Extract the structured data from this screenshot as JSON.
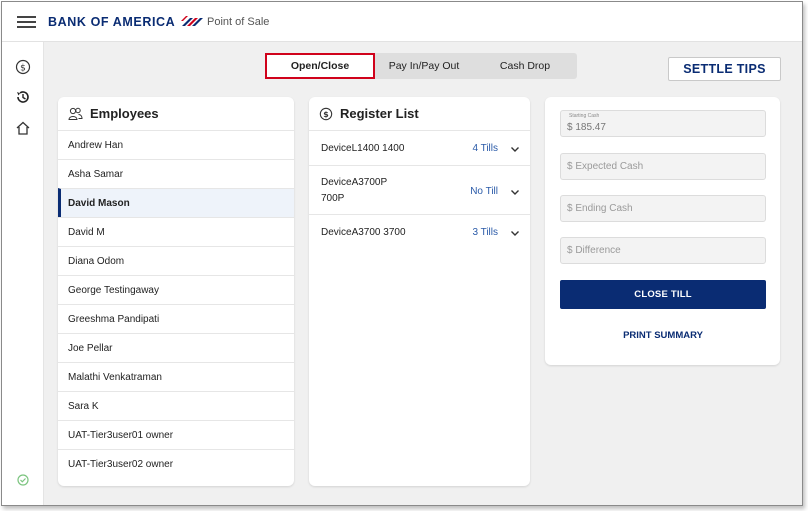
{
  "header": {
    "brand": "BANK OF AMERICA",
    "app_name": "Point of Sale"
  },
  "nav": {
    "icons": [
      "dollar-circle-icon",
      "history-icon",
      "home-icon"
    ],
    "status_icon": "check-circle-icon"
  },
  "tabs": [
    {
      "label": "Open/Close",
      "active": true
    },
    {
      "label": "Pay In/Pay Out",
      "active": false
    },
    {
      "label": "Cash Drop",
      "active": false
    }
  ],
  "settle_tips_label": "SETTLE TIPS",
  "employees": {
    "title": "Employees",
    "items": [
      "Andrew Han",
      "Asha Samar",
      "David Mason",
      "David M",
      "Diana Odom",
      "George Testingaway",
      "Greeshma Pandipati",
      "Joe Pellar",
      "Malathi Venkatraman",
      "Sara K",
      "UAT-Tier3user01 owner",
      "UAT-Tier3user02 owner"
    ],
    "selected": "David Mason"
  },
  "registers": {
    "title": "Register List",
    "items": [
      {
        "name": "DeviceL1400 1400",
        "tills": "4 Tills"
      },
      {
        "name_line1": "DeviceA3700P",
        "name_line2": "700P",
        "tills": "No Till"
      },
      {
        "name": "DeviceA3700 3700",
        "tills": "3 Tills"
      }
    ]
  },
  "cash": {
    "starting_label": "Starting Cash",
    "starting_value": "$ 185.47",
    "expected_placeholder": "$ Expected Cash",
    "ending_placeholder": "$ Ending Cash",
    "difference_placeholder": "$ Difference",
    "close_till": "CLOSE TILL",
    "print_summary": "PRINT SUMMARY"
  },
  "colors": {
    "brand_navy": "#0a2c73",
    "accent_red": "#d0021b",
    "link_blue": "#2a5aa8"
  }
}
